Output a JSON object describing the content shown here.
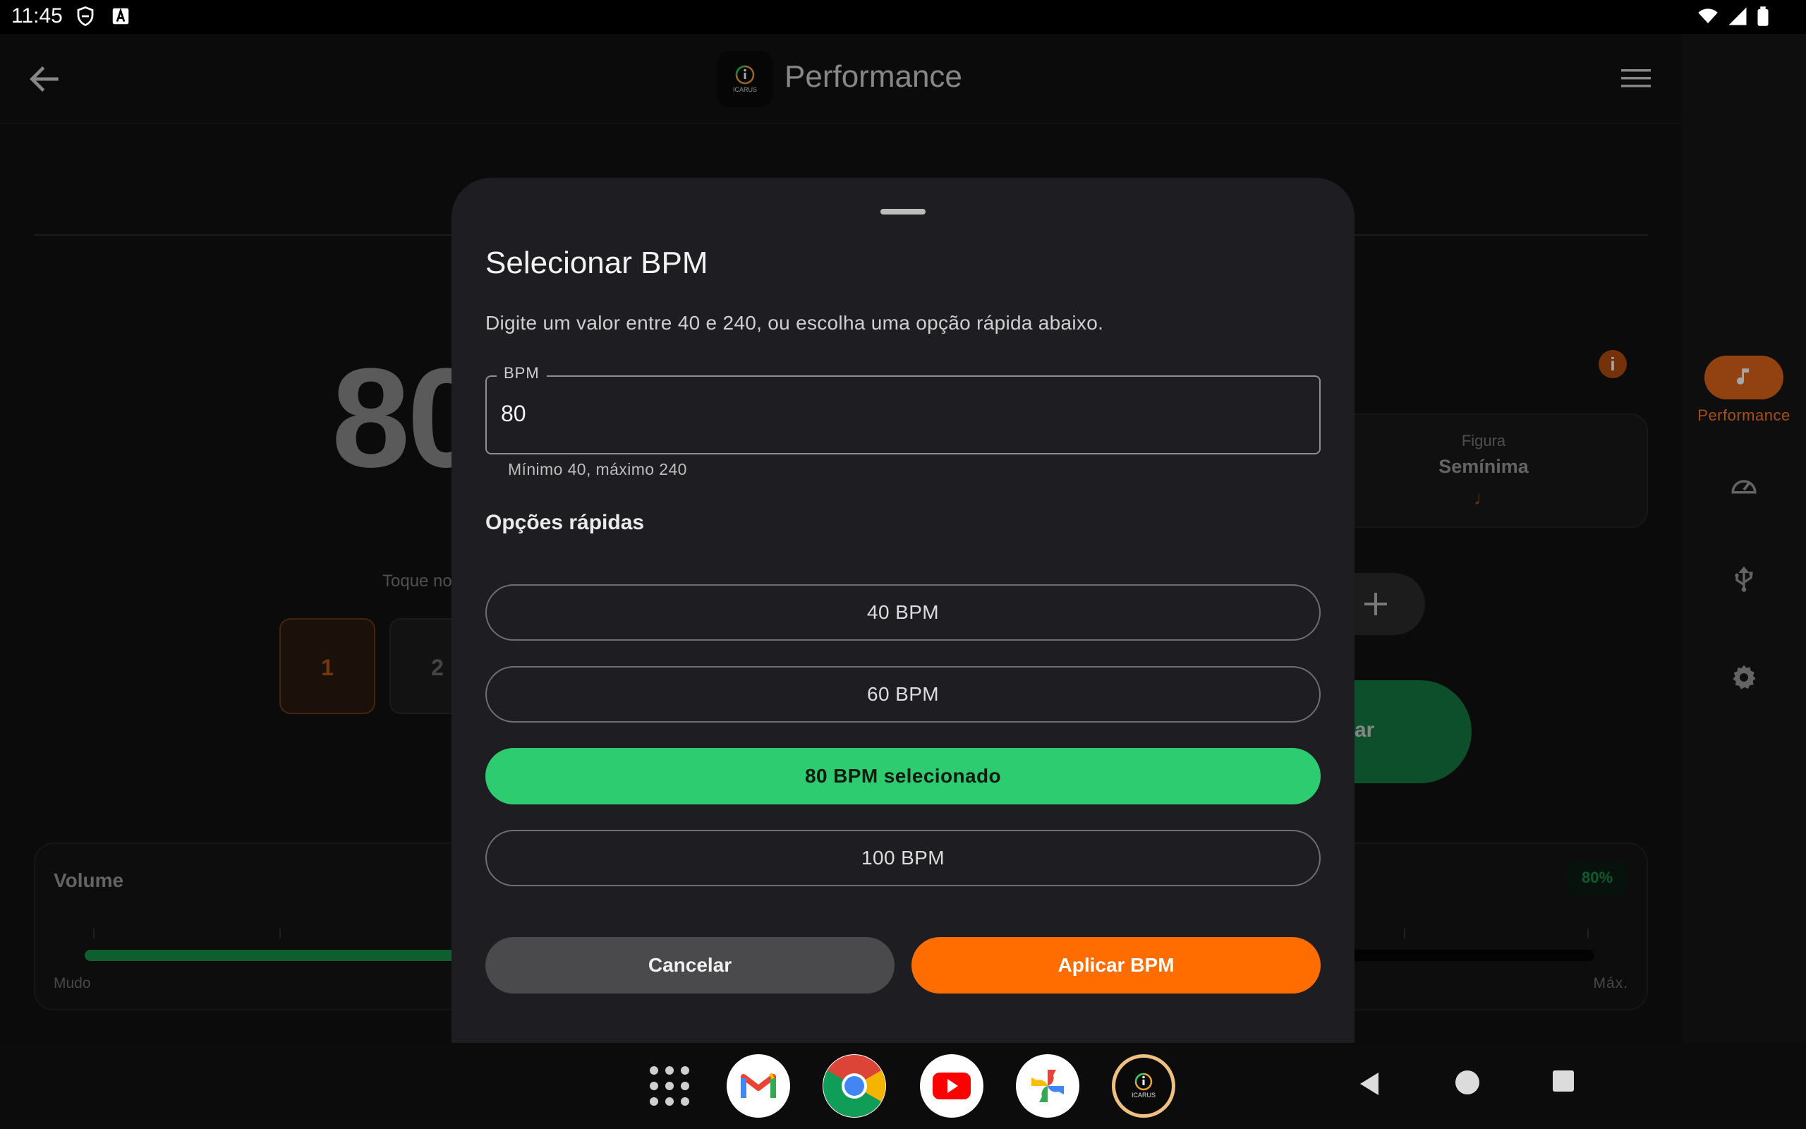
{
  "status_bar": {
    "time": "11:45",
    "left_icons": [
      "shield-icon",
      "font-download-icon"
    ],
    "right_icons": [
      "wifi-icon",
      "signal-icon",
      "battery-icon"
    ]
  },
  "app_bar": {
    "title": "Performance",
    "logo_text": "ICARUS"
  },
  "nav_rail": {
    "items": [
      {
        "label": "Performance",
        "icon": "music-note-icon",
        "active": true
      },
      {
        "label": "",
        "icon": "speedometer-icon",
        "active": false
      },
      {
        "label": "",
        "icon": "usb-icon",
        "active": false
      },
      {
        "label": "",
        "icon": "gear-icon",
        "active": false
      }
    ]
  },
  "background": {
    "bpm_value": "80",
    "figure_label": "Figura",
    "figure_value": "Semínima",
    "figure_symbol": "♩",
    "tap_hint": "Toque no",
    "beats": [
      "1",
      "2"
    ],
    "start_button_partial": "ar",
    "volume": {
      "title": "Volume",
      "percent_label": "80%",
      "level": 0.8,
      "min_label": "Mudo",
      "max_label": "Máx."
    }
  },
  "sheet": {
    "title": "Selecionar BPM",
    "description": "Digite um valor entre 40 e 240, ou escolha uma opção rápida abaixo.",
    "field": {
      "label": "BPM",
      "value": "80",
      "helper": "Mínimo 40, máximo 240"
    },
    "quick_title": "Opções rápidas",
    "options": [
      {
        "label": "40 BPM",
        "selected": false
      },
      {
        "label": "60 BPM",
        "selected": false
      },
      {
        "label": "80 BPM selecionado",
        "selected": true
      },
      {
        "label": "100 BPM",
        "selected": false
      }
    ],
    "cancel_label": "Cancelar",
    "apply_label": "Aplicar BPM"
  },
  "taskbar": {
    "apps": [
      "app-drawer-icon",
      "gmail-icon",
      "chrome-icon",
      "youtube-icon",
      "photos-icon",
      "icarus-icon"
    ],
    "icarus_label": "ICARUS",
    "nav": [
      "back-nav-icon",
      "home-nav-icon",
      "recents-nav-icon"
    ]
  },
  "colors": {
    "accent_orange": "#ff6c00",
    "accent_green": "#2ecc71",
    "sheet_bg": "#1e1d21"
  }
}
